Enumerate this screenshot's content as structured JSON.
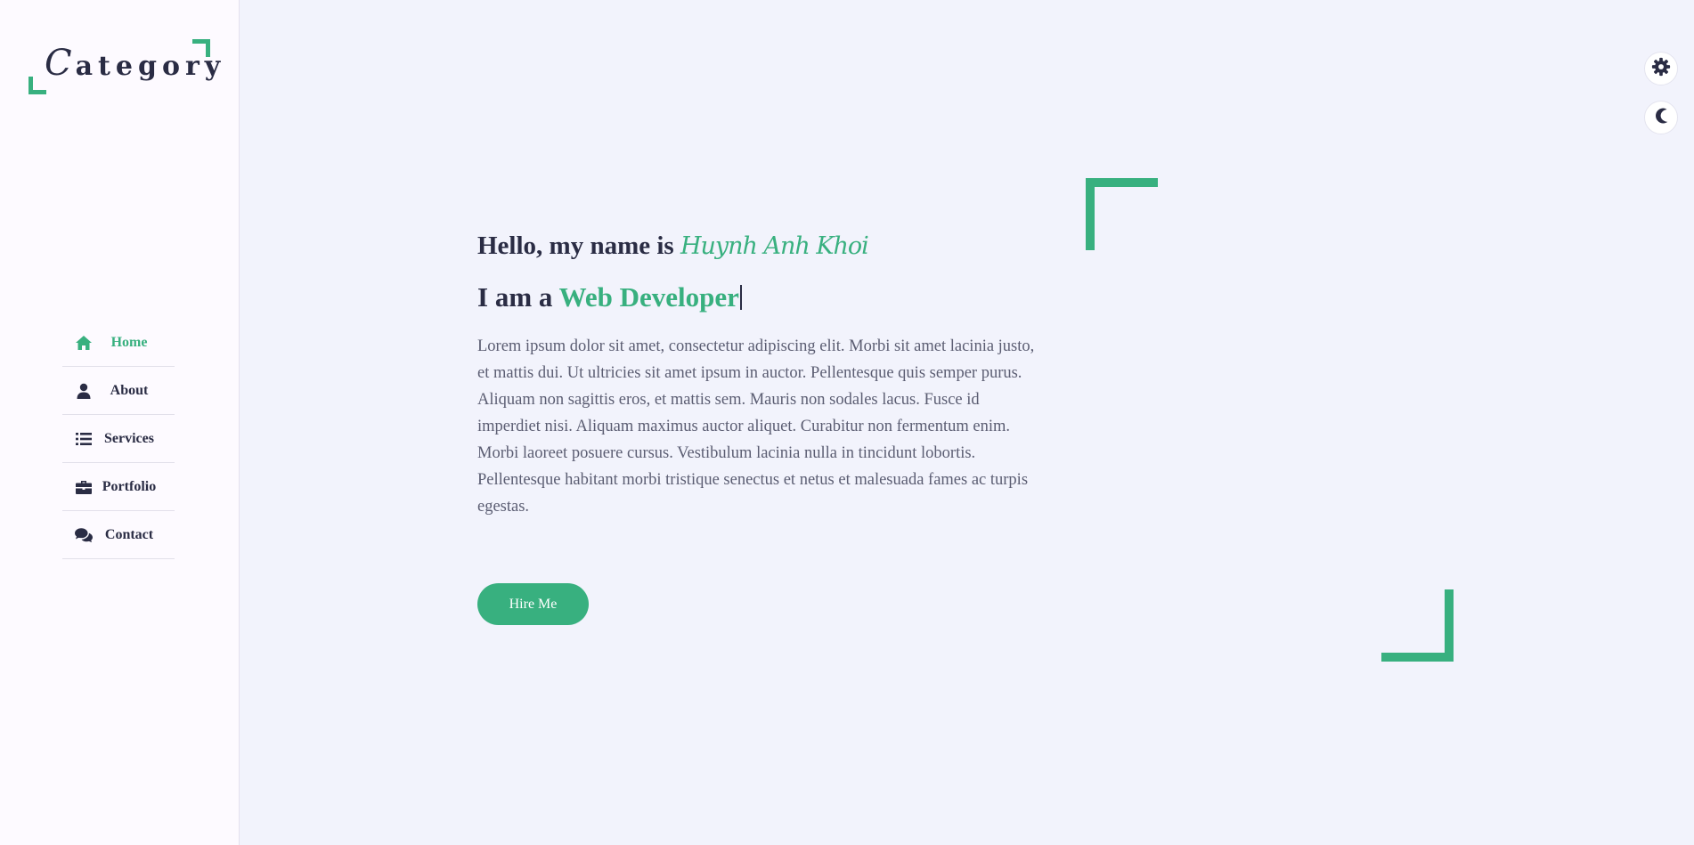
{
  "sidebar": {
    "logo": {
      "initial": "C",
      "rest": "ategory"
    },
    "items": [
      {
        "label": "Home",
        "icon": "home-icon",
        "active": true
      },
      {
        "label": "About",
        "icon": "user-icon",
        "active": false
      },
      {
        "label": "Services",
        "icon": "list-icon",
        "active": false
      },
      {
        "label": "Portfolio",
        "icon": "briefcase-icon",
        "active": false
      },
      {
        "label": "Contact",
        "icon": "comments-icon",
        "active": false
      }
    ]
  },
  "controls": {
    "settings_icon": "gear-icon",
    "theme_icon": "moon-icon"
  },
  "hero": {
    "greeting_prefix": "Hello, my name is",
    "name": "Huynh Anh Khoi",
    "role_prefix": "I am a",
    "role": "Web Developer",
    "bio": "Lorem ipsum dolor sit amet, consectetur adipiscing elit. Morbi sit amet lacinia justo, et mattis dui. Ut ultricies sit amet ipsum in auctor. Pellentesque quis semper purus. Aliquam non sagittis eros, et mattis sem. Mauris non sodales lacus. Fusce id imperdiet nisi. Aliquam maximus auctor aliquet. Curabitur non fermentum enim. Morbi laoreet posuere cursus. Vestibulum lacinia nulla in tincidunt lobortis. Pellentesque habitant morbi tristique senectus et netus et malesuada fames ac turpis egestas.",
    "cta_label": "Hire Me"
  },
  "colors": {
    "accent": "#38b07f",
    "text": "#2a2c44",
    "background": "#f2f3fc",
    "sidebar_background": "#fdfaff"
  }
}
